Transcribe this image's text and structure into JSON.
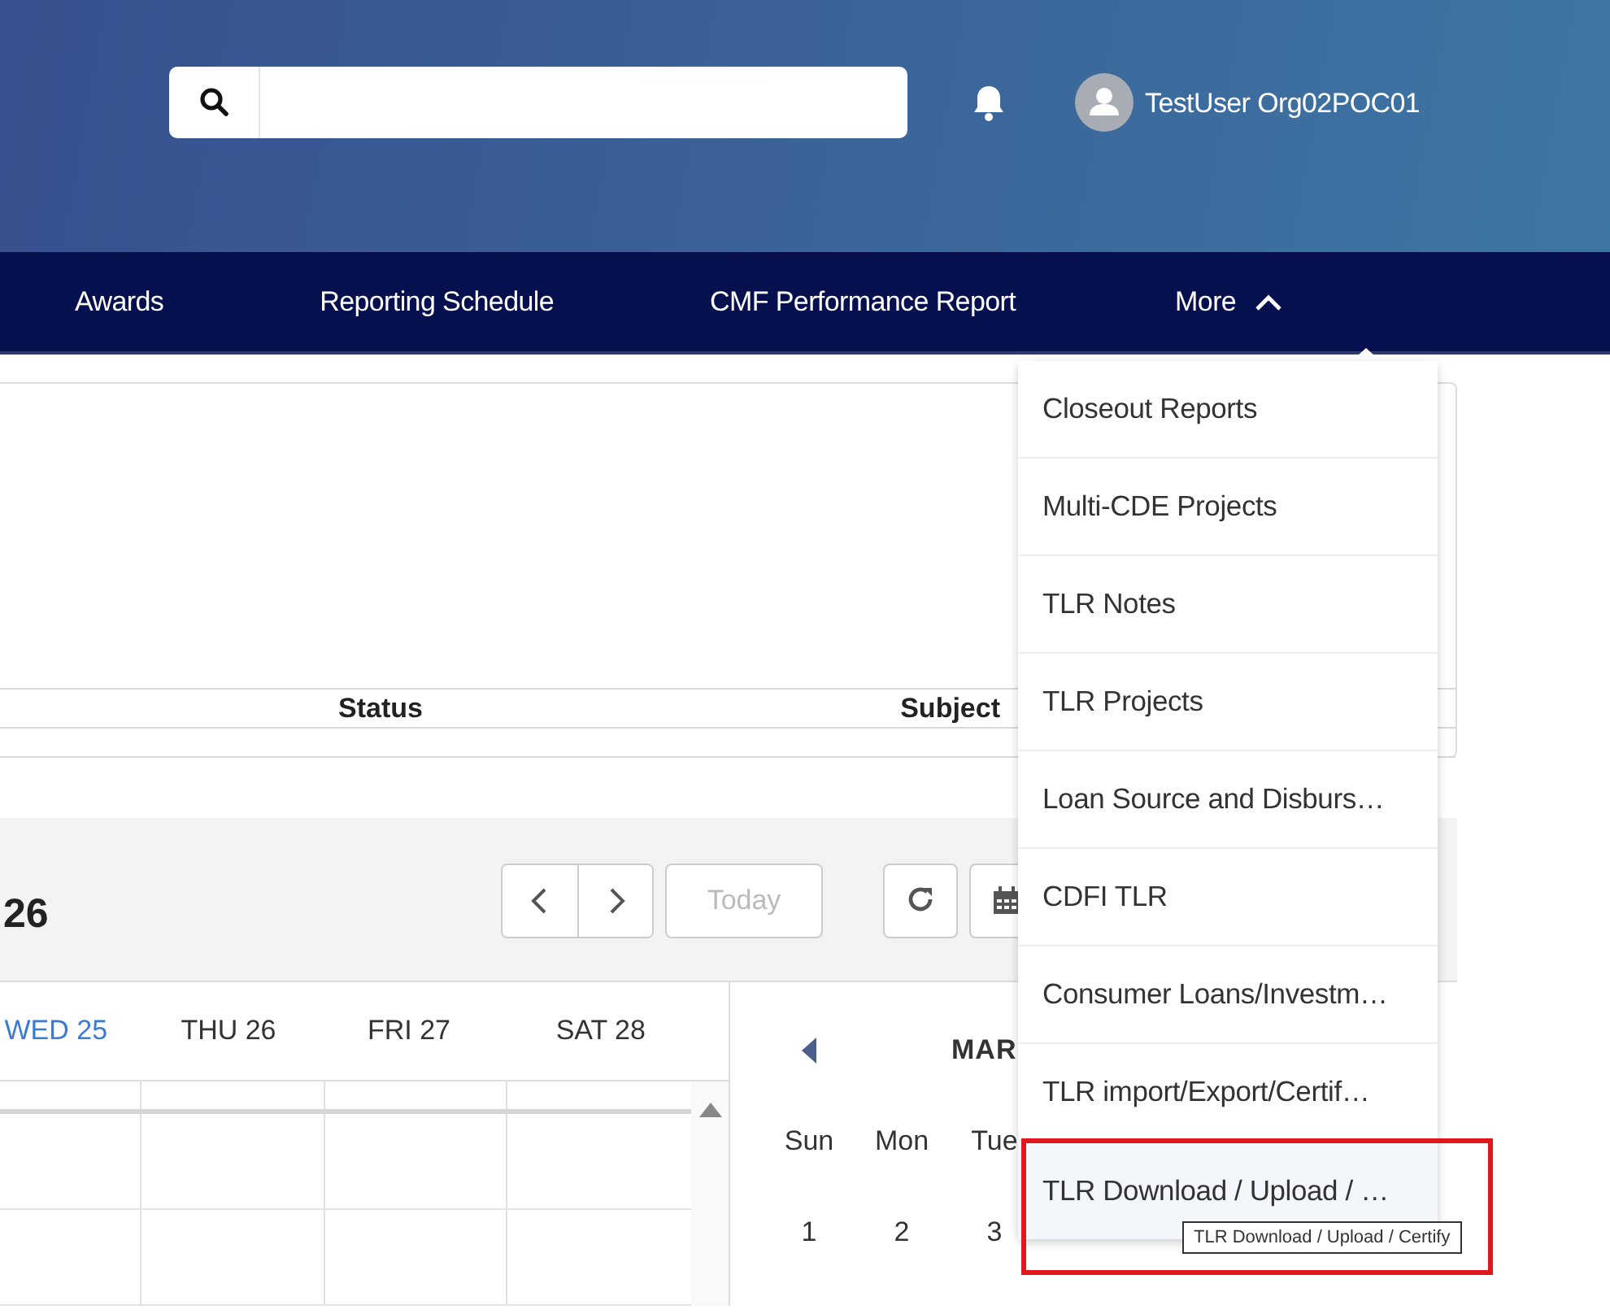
{
  "header": {
    "user_name": "TestUser Org02POC01"
  },
  "nav": {
    "items": [
      {
        "label": "Awards",
        "selected": false
      },
      {
        "label": "Reporting Schedule",
        "selected": false
      },
      {
        "label": "CMF Performance Report",
        "selected": false
      },
      {
        "label": "More",
        "selected": false,
        "expanded": true
      }
    ]
  },
  "more_menu": {
    "items": [
      {
        "label": "Closeout Reports",
        "selected": false,
        "highlighted": false
      },
      {
        "label": "Multi-CDE Projects",
        "selected": false,
        "highlighted": false
      },
      {
        "label": "TLR Notes",
        "selected": false,
        "highlighted": false
      },
      {
        "label": "TLR Projects",
        "selected": false,
        "highlighted": false
      },
      {
        "label": "Loan Source and Disburs…",
        "selected": false,
        "highlighted": false
      },
      {
        "label": "CDFI TLR",
        "selected": false,
        "highlighted": false
      },
      {
        "label": "Consumer Loans/Investm…",
        "selected": false,
        "highlighted": false
      },
      {
        "label": "TLR import/Export/Certif…",
        "selected": false,
        "highlighted": false
      },
      {
        "label": "TLR Download / Upload / …",
        "selected": true,
        "highlighted": true,
        "tooltip": "TLR Download / Upload / Certify"
      }
    ]
  },
  "table": {
    "columns": [
      "Status",
      "Subject"
    ]
  },
  "calendar": {
    "title": "26",
    "today_button": {
      "label": "Today",
      "disabled": true
    },
    "days": [
      {
        "label": "WED 25",
        "selected": true
      },
      {
        "label": "THU 26",
        "selected": false
      },
      {
        "label": "FRI 27",
        "selected": false
      },
      {
        "label": "SAT 28",
        "selected": false
      }
    ],
    "mini": {
      "month": "MAR",
      "weekdays": [
        "Sun",
        "Mon",
        "Tue"
      ],
      "dates": [
        "1",
        "2",
        "3"
      ]
    }
  }
}
